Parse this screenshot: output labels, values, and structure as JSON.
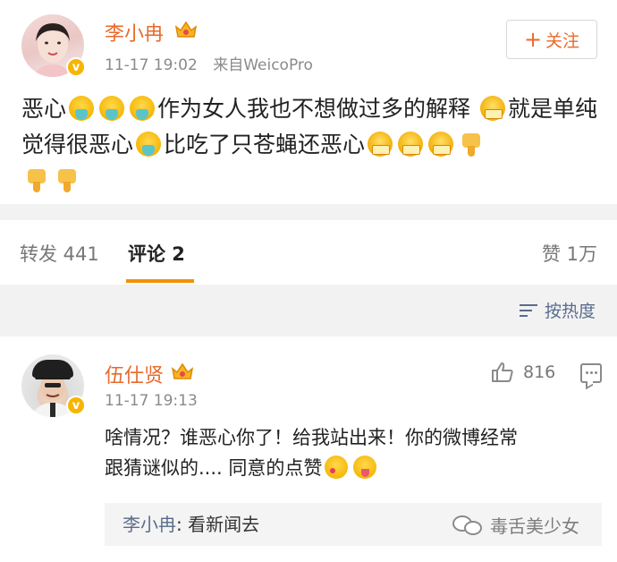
{
  "post": {
    "username": "李小冉",
    "time": "11-17 19:02",
    "source": "来自WeicoPro",
    "follow_label": "关注",
    "follow_plus": "+",
    "text": {
      "part1": "恶心",
      "part2": "作为女人我也不想做过多的解释",
      "part3": "就是单纯觉得很恶心",
      "part4": "比吃了只苍蝇还恶心"
    },
    "icons": {
      "avatar": "avatar-photo",
      "verified": "verified-badge-icon",
      "crown": "vip-crown-icon",
      "emoji_vomit": "vomit-emoji-icon",
      "emoji_angry": "angry-grimace-emoji-icon",
      "emoji_thumbs_down": "thumbs-down-emoji-icon"
    }
  },
  "tabs": {
    "repost": "转发 441",
    "comments": "评论 2",
    "likes": "赞 1万",
    "active": "comments",
    "accent": "#f29100"
  },
  "sort": {
    "label": "按热度",
    "icon": "sort-lines-icon"
  },
  "comment": {
    "username": "伍仕贤",
    "time": "11-17 19:13",
    "like_count": "816",
    "text_line1": "啥情况？谁恶心你了！给我站出来！你的微博经常",
    "text_line2": "跟猜谜似的.... 同意的点赞",
    "reply": {
      "user": "李小冉",
      "separator": ": ",
      "text": "看新闻去"
    },
    "icons": {
      "like": "thumbs-up-icon",
      "reply": "comment-bubble-icon",
      "emoji_kiss": "blowing-kiss-emoji-icon",
      "emoji_tongue": "winking-tongue-emoji-icon"
    }
  },
  "watermark": {
    "text": "毒舌美少女",
    "icon": "wechat-icon"
  },
  "colors": {
    "username": "#e86a2b",
    "link_blue": "#5a6c8c",
    "verified": "#f7b500",
    "background_band": "#f2f2f2"
  }
}
